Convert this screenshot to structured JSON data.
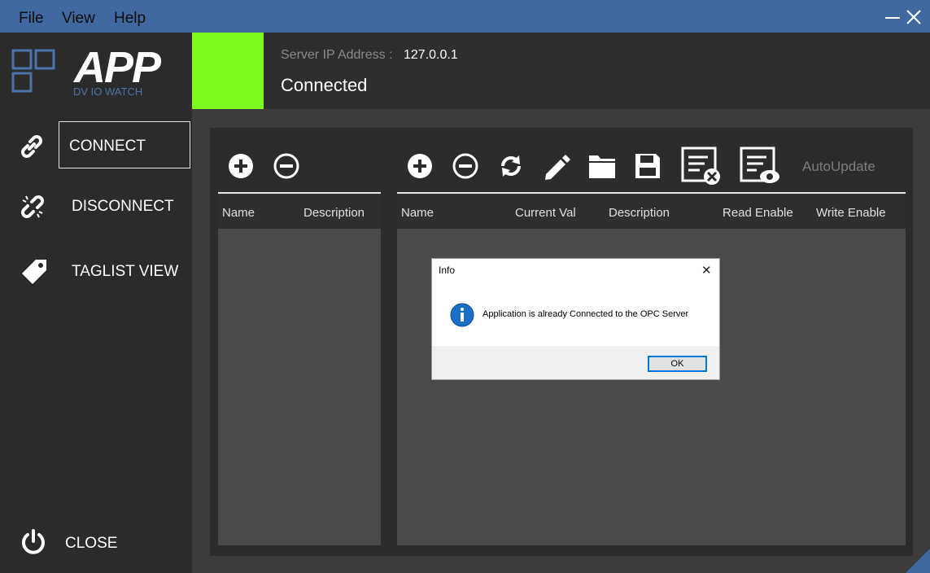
{
  "menu": {
    "file": "File",
    "view": "View",
    "help": "Help"
  },
  "logo": {
    "app": "APP",
    "subtitle": "DV IO WATCH"
  },
  "nav": {
    "connect": "CONNECT",
    "disconnect": "DISCONNECT",
    "taglist": "TAGLIST VIEW",
    "close": "CLOSE"
  },
  "server": {
    "ip_label": "Server IP Address :",
    "ip_value": "127.0.0.1",
    "status": "Connected",
    "status_color": "#7dfa1e"
  },
  "left_table": {
    "columns": [
      "Name",
      "Description"
    ]
  },
  "right_table": {
    "columns": [
      "Name",
      "Current Val",
      "Description",
      "Read Enable",
      "Write Enable"
    ]
  },
  "toolbar": {
    "autoupdate": "AutoUpdate"
  },
  "dialog": {
    "title": "Info",
    "close": "✕",
    "message": "Application is already Connected to the OPC Server",
    "ok": "OK"
  },
  "colors": {
    "accent": "#3f69a0",
    "panel": "#2c2c2c",
    "body": "#4a4a4a"
  }
}
